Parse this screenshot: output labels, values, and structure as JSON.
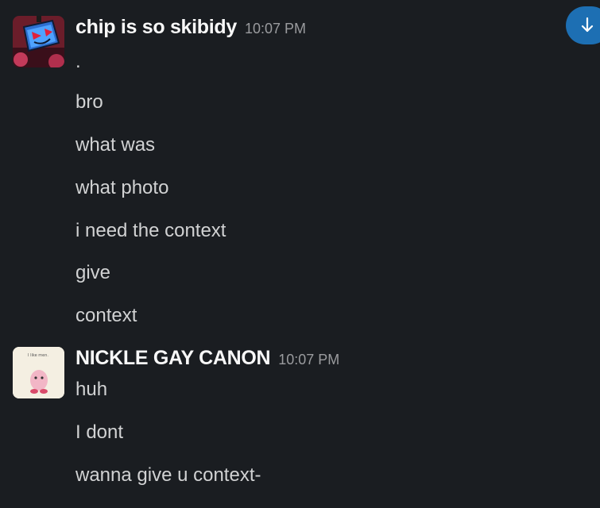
{
  "jump_button": {
    "icon": "arrow-down-icon"
  },
  "groups": [
    {
      "author": "chip is so skibidy",
      "time": "10:07 PM",
      "avatar": {
        "icon": "robot-avatar"
      },
      "lines": [
        ".",
        "bro",
        "what was",
        "what photo",
        "i need the context",
        "give",
        "context"
      ]
    },
    {
      "author": "NICKLE GAY CANON",
      "time": "10:07 PM",
      "avatar": {
        "icon": "meme-avatar",
        "caption": "I like men."
      },
      "lines": [
        "huh",
        "I dont",
        "wanna give u context-"
      ]
    }
  ]
}
